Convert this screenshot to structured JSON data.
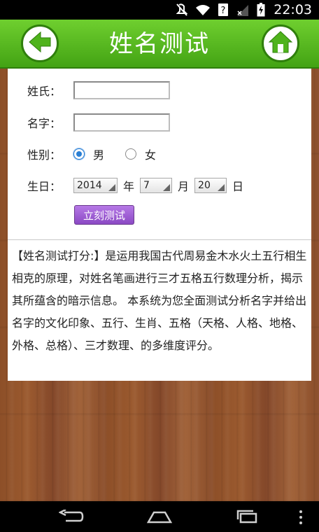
{
  "status_bar": {
    "time": "22:03",
    "icons": [
      "mute-icon",
      "wifi-icon",
      "help-icon",
      "signal-icon",
      "battery-charging-icon"
    ]
  },
  "header": {
    "title": "姓名测试",
    "back_icon": "back-arrow-icon",
    "home_icon": "home-icon",
    "accent_color": "#4fb31c"
  },
  "form": {
    "surname_label": "姓氏：",
    "surname_value": "",
    "given_name_label": "名字：",
    "given_name_value": "",
    "gender_label": "性别：",
    "gender_male": "男",
    "gender_female": "女",
    "gender_selected": "男",
    "birthday_label": "生日：",
    "year_value": "2014",
    "year_unit": "年",
    "month_value": "7",
    "month_unit": "月",
    "day_value": "20",
    "day_unit": "日",
    "submit_label": "立刻测试"
  },
  "description": "【姓名测试打分:】是运用我国古代周易金木水火土五行相生相克的原理，对姓名笔画进行三才五格五行数理分析，揭示其所蕴含的暗示信息。 本系统为您全面测试分析名字并给出名字的文化印象、五行、生肖、五格（天格、人格、地格、外格、总格）、三才数理、的多维度评分。",
  "nav_bar": {
    "icons": [
      "back-icon",
      "home-icon",
      "recent-apps-icon",
      "menu-icon"
    ]
  }
}
